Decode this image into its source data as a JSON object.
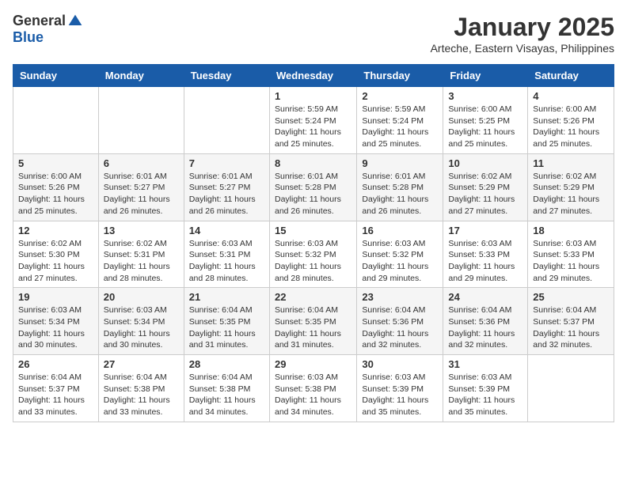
{
  "logo": {
    "general": "General",
    "blue": "Blue"
  },
  "title": "January 2025",
  "subtitle": "Arteche, Eastern Visayas, Philippines",
  "days_of_week": [
    "Sunday",
    "Monday",
    "Tuesday",
    "Wednesday",
    "Thursday",
    "Friday",
    "Saturday"
  ],
  "weeks": [
    [
      {
        "day": "",
        "sunrise": "",
        "sunset": "",
        "daylight": ""
      },
      {
        "day": "",
        "sunrise": "",
        "sunset": "",
        "daylight": ""
      },
      {
        "day": "",
        "sunrise": "",
        "sunset": "",
        "daylight": ""
      },
      {
        "day": "1",
        "sunrise": "Sunrise: 5:59 AM",
        "sunset": "Sunset: 5:24 PM",
        "daylight": "Daylight: 11 hours and 25 minutes."
      },
      {
        "day": "2",
        "sunrise": "Sunrise: 5:59 AM",
        "sunset": "Sunset: 5:24 PM",
        "daylight": "Daylight: 11 hours and 25 minutes."
      },
      {
        "day": "3",
        "sunrise": "Sunrise: 6:00 AM",
        "sunset": "Sunset: 5:25 PM",
        "daylight": "Daylight: 11 hours and 25 minutes."
      },
      {
        "day": "4",
        "sunrise": "Sunrise: 6:00 AM",
        "sunset": "Sunset: 5:26 PM",
        "daylight": "Daylight: 11 hours and 25 minutes."
      }
    ],
    [
      {
        "day": "5",
        "sunrise": "Sunrise: 6:00 AM",
        "sunset": "Sunset: 5:26 PM",
        "daylight": "Daylight: 11 hours and 25 minutes."
      },
      {
        "day": "6",
        "sunrise": "Sunrise: 6:01 AM",
        "sunset": "Sunset: 5:27 PM",
        "daylight": "Daylight: 11 hours and 26 minutes."
      },
      {
        "day": "7",
        "sunrise": "Sunrise: 6:01 AM",
        "sunset": "Sunset: 5:27 PM",
        "daylight": "Daylight: 11 hours and 26 minutes."
      },
      {
        "day": "8",
        "sunrise": "Sunrise: 6:01 AM",
        "sunset": "Sunset: 5:28 PM",
        "daylight": "Daylight: 11 hours and 26 minutes."
      },
      {
        "day": "9",
        "sunrise": "Sunrise: 6:01 AM",
        "sunset": "Sunset: 5:28 PM",
        "daylight": "Daylight: 11 hours and 26 minutes."
      },
      {
        "day": "10",
        "sunrise": "Sunrise: 6:02 AM",
        "sunset": "Sunset: 5:29 PM",
        "daylight": "Daylight: 11 hours and 27 minutes."
      },
      {
        "day": "11",
        "sunrise": "Sunrise: 6:02 AM",
        "sunset": "Sunset: 5:29 PM",
        "daylight": "Daylight: 11 hours and 27 minutes."
      }
    ],
    [
      {
        "day": "12",
        "sunrise": "Sunrise: 6:02 AM",
        "sunset": "Sunset: 5:30 PM",
        "daylight": "Daylight: 11 hours and 27 minutes."
      },
      {
        "day": "13",
        "sunrise": "Sunrise: 6:02 AM",
        "sunset": "Sunset: 5:31 PM",
        "daylight": "Daylight: 11 hours and 28 minutes."
      },
      {
        "day": "14",
        "sunrise": "Sunrise: 6:03 AM",
        "sunset": "Sunset: 5:31 PM",
        "daylight": "Daylight: 11 hours and 28 minutes."
      },
      {
        "day": "15",
        "sunrise": "Sunrise: 6:03 AM",
        "sunset": "Sunset: 5:32 PM",
        "daylight": "Daylight: 11 hours and 28 minutes."
      },
      {
        "day": "16",
        "sunrise": "Sunrise: 6:03 AM",
        "sunset": "Sunset: 5:32 PM",
        "daylight": "Daylight: 11 hours and 29 minutes."
      },
      {
        "day": "17",
        "sunrise": "Sunrise: 6:03 AM",
        "sunset": "Sunset: 5:33 PM",
        "daylight": "Daylight: 11 hours and 29 minutes."
      },
      {
        "day": "18",
        "sunrise": "Sunrise: 6:03 AM",
        "sunset": "Sunset: 5:33 PM",
        "daylight": "Daylight: 11 hours and 29 minutes."
      }
    ],
    [
      {
        "day": "19",
        "sunrise": "Sunrise: 6:03 AM",
        "sunset": "Sunset: 5:34 PM",
        "daylight": "Daylight: 11 hours and 30 minutes."
      },
      {
        "day": "20",
        "sunrise": "Sunrise: 6:03 AM",
        "sunset": "Sunset: 5:34 PM",
        "daylight": "Daylight: 11 hours and 30 minutes."
      },
      {
        "day": "21",
        "sunrise": "Sunrise: 6:04 AM",
        "sunset": "Sunset: 5:35 PM",
        "daylight": "Daylight: 11 hours and 31 minutes."
      },
      {
        "day": "22",
        "sunrise": "Sunrise: 6:04 AM",
        "sunset": "Sunset: 5:35 PM",
        "daylight": "Daylight: 11 hours and 31 minutes."
      },
      {
        "day": "23",
        "sunrise": "Sunrise: 6:04 AM",
        "sunset": "Sunset: 5:36 PM",
        "daylight": "Daylight: 11 hours and 32 minutes."
      },
      {
        "day": "24",
        "sunrise": "Sunrise: 6:04 AM",
        "sunset": "Sunset: 5:36 PM",
        "daylight": "Daylight: 11 hours and 32 minutes."
      },
      {
        "day": "25",
        "sunrise": "Sunrise: 6:04 AM",
        "sunset": "Sunset: 5:37 PM",
        "daylight": "Daylight: 11 hours and 32 minutes."
      }
    ],
    [
      {
        "day": "26",
        "sunrise": "Sunrise: 6:04 AM",
        "sunset": "Sunset: 5:37 PM",
        "daylight": "Daylight: 11 hours and 33 minutes."
      },
      {
        "day": "27",
        "sunrise": "Sunrise: 6:04 AM",
        "sunset": "Sunset: 5:38 PM",
        "daylight": "Daylight: 11 hours and 33 minutes."
      },
      {
        "day": "28",
        "sunrise": "Sunrise: 6:04 AM",
        "sunset": "Sunset: 5:38 PM",
        "daylight": "Daylight: 11 hours and 34 minutes."
      },
      {
        "day": "29",
        "sunrise": "Sunrise: 6:03 AM",
        "sunset": "Sunset: 5:38 PM",
        "daylight": "Daylight: 11 hours and 34 minutes."
      },
      {
        "day": "30",
        "sunrise": "Sunrise: 6:03 AM",
        "sunset": "Sunset: 5:39 PM",
        "daylight": "Daylight: 11 hours and 35 minutes."
      },
      {
        "day": "31",
        "sunrise": "Sunrise: 6:03 AM",
        "sunset": "Sunset: 5:39 PM",
        "daylight": "Daylight: 11 hours and 35 minutes."
      },
      {
        "day": "",
        "sunrise": "",
        "sunset": "",
        "daylight": ""
      }
    ]
  ]
}
